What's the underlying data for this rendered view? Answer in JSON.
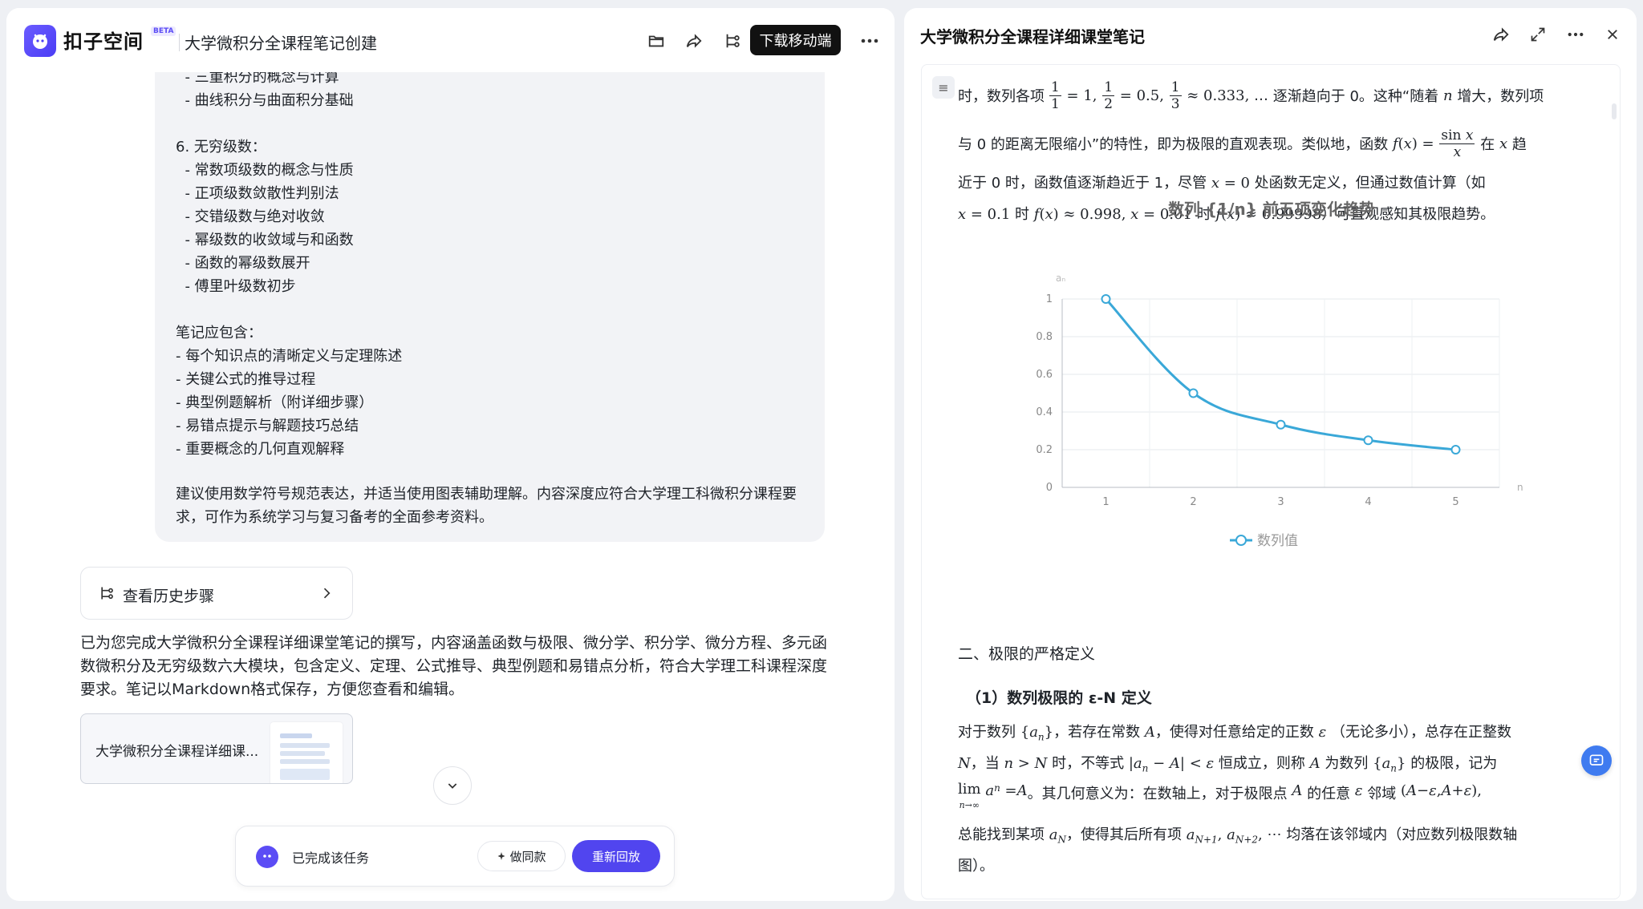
{
  "app": {
    "brand": "扣子空间",
    "beta": "BETA",
    "title": "大学微积分全课程笔记创建",
    "download_button": "下载移动端"
  },
  "icons": {
    "folder": "folder-icon",
    "share": "share-icon",
    "workflow": "workflow-icon",
    "more": "more-icon",
    "expand": "expand-icon",
    "close": "close-icon"
  },
  "bubble": {
    "lines": [
      "  - 三重积分的概念与计算",
      "  - 曲线积分与曲面积分基础",
      "",
      "6. 无穷级数：",
      "  - 常数项级数的概念与性质",
      "  - 正项级数敛散性判别法",
      "  - 交错级数与绝对收敛",
      "  - 幂级数的收敛域与和函数",
      "  - 函数的幂级数展开",
      "  - 傅里叶级数初步",
      "",
      "笔记应包含：",
      "- 每个知识点的清晰定义与定理陈述",
      "- 关键公式的推导过程",
      "- 典型例题解析（附详细步骤）",
      "- 易错点提示与解题技巧总结",
      "- 重要概念的几何直观解释"
    ],
    "closing": "建议使用数学符号规范表达，并适当使用图表辅助理解。内容深度应符合大学理工科微积分课程要求，可作为系统学习与复习备考的全面参考资料。"
  },
  "history_button": "查看历史步骤",
  "summary": "已为您完成大学微积分全课程详细课堂笔记的撰写，内容涵盖函数与极限、微分学、积分学、微分方程、多元函数微积分及无穷级数六大模块，包含定义、定理、公式推导、典型例题和易错点分析，符合大学理工科课程深度要求。笔记以Markdown格式保存，方便您查看和编辑。",
  "file_card": "大学微积分全课程详细课...",
  "taskbar": {
    "status": "已完成该任务",
    "same_button": "做同款",
    "replay_button": "重新回放"
  },
  "doc": {
    "title": "大学微积分全课程详细课堂笔记",
    "p1": {
      "a": "时，数列各项",
      "b": "逐渐趋向于 0。这种“随着",
      "c": "增大，数列项",
      "d": "与 0 的距离无限缩小”的特性，即为极限的直观表现。类似地，函数",
      "e": "在",
      "f": "趋",
      "g": "近于 0 时，函数值逐渐趋近于 1，尽管",
      "h": "处函数无定义，但通过数值计算（如",
      "i": "时",
      "j": "时",
      "k": "）可直观感知其极限趋势。"
    },
    "section2": "二、极限的严格定义",
    "subsection1": "（1）数列极限的 ε-N 定义",
    "p2": {
      "a": "对于数列",
      "b": "，若存在常数",
      "c": "，使得对任意给定的正数",
      "d": "（无论多小），总存在正整数",
      "e": "，当",
      "f": "时，不等式",
      "g": "恒成立，则称",
      "h": "为数列",
      "i": "的极限，记为",
      "j": "。其几何意义为：在数轴上，对于极限点",
      "k": "的任意",
      "l": "邻域",
      "m": "总能找到某项",
      "n": "，使得其后所有项",
      "o": "均落在该邻域内（对应数列极限数轴",
      "p": "图）。"
    }
  },
  "chart_data": {
    "type": "line",
    "title": "数列 {1/n} 前五项变化趋势",
    "xlabel": "n",
    "ylabel": "aₙ",
    "categories": [
      1,
      2,
      3,
      4,
      5
    ],
    "series": [
      {
        "name": "数列值",
        "values": [
          1,
          0.5,
          0.333,
          0.25,
          0.2
        ]
      }
    ],
    "ylim": [
      0,
      1
    ],
    "yticks": [
      0,
      0.2,
      0.4,
      0.6,
      0.8,
      1
    ],
    "grid": true,
    "legend": "bottom",
    "color": "#3aa8d8"
  }
}
